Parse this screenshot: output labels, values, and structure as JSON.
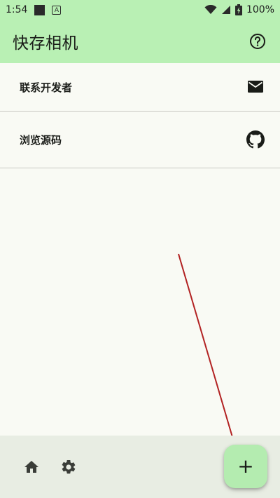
{
  "status_bar": {
    "time": "1:54",
    "battery_text": "100%",
    "icons": [
      "notification-square-icon",
      "notification-a-icon",
      "wifi-icon",
      "signal-icon",
      "battery-charging-icon"
    ]
  },
  "app_bar": {
    "title": "快存相机",
    "help_icon": "help-circle-icon"
  },
  "list": {
    "items": [
      {
        "label": "联系开发者",
        "icon": "email-icon"
      },
      {
        "label": "浏览源码",
        "icon": "github-icon"
      }
    ]
  },
  "bottom_bar": {
    "home_icon": "home-icon",
    "settings_icon": "gear-icon",
    "fab_icon": "+"
  },
  "colors": {
    "primary_container": "#b9f0b4",
    "background": "#f9faf4",
    "bottom_bar": "#e8ede3",
    "fab": "#b4ecb0",
    "annotation_arrow": "#b22222"
  }
}
